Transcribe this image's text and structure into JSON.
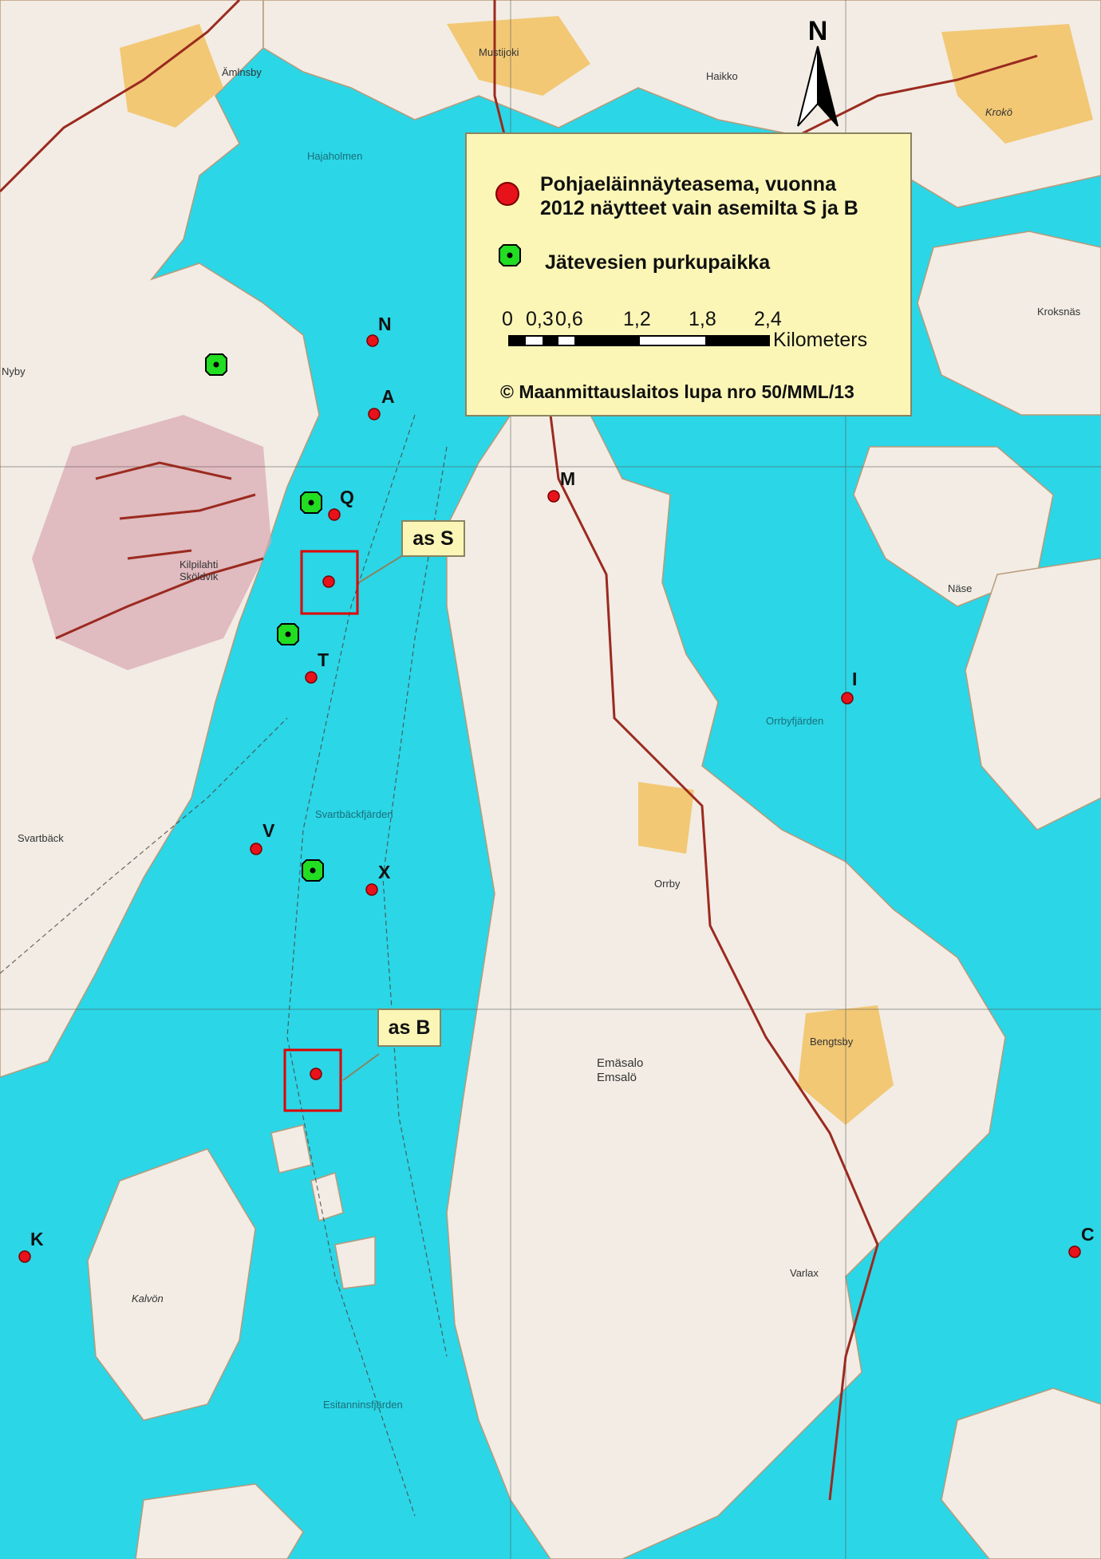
{
  "legend": {
    "station_text_line1": "Pohjaeläinnäyteasema, vuonna",
    "station_text_line2": "2012 näytteet vain asemilta S ja B",
    "outfall_text": "Jätevesien purkupaikka",
    "scale_ticks": [
      "0",
      "0,3",
      "0,6",
      "1,2",
      "1,8",
      "2,4"
    ],
    "scale_unit": "Kilometers",
    "copyright": "© Maanmittauslaitos lupa nro 50/MML/13"
  },
  "north_label": "N",
  "callouts": {
    "s": "as S",
    "b": "as B"
  },
  "stations": [
    "N",
    "A",
    "Q",
    "M",
    "T",
    "I",
    "V",
    "X",
    "K",
    "C"
  ],
  "place_labels": {
    "kilpilahti": "Kilpilahti",
    "skoldvik": "Sköldvik",
    "svartback": "Svartbäck",
    "svartbackfjarden": "Svartbäckfjärden",
    "orrbyfjarden": "Orrbyfjärden",
    "orrby": "Orrby",
    "emasalo": "Emäsalo",
    "emsalo": "Emsalö",
    "bengtsby": "Bengtsby",
    "varlax": "Varlax",
    "kalvon": "Kalvön",
    "esitanninsfjarden": "Esitanninsfjärden",
    "kroko": "Krokö",
    "kroksnas": "Kroksnäs",
    "nybyt": "Nyby",
    "amlnsby": "Ämlnsby",
    "hajaholmen": "Hajaholmen",
    "mustijoki": "Mustijoki",
    "haikko": "Haikko",
    "nase": "Näse"
  },
  "colors": {
    "water": "#2bd6e6",
    "land": "#f2ece4",
    "field": "#f2c261",
    "urban": "#d9a6b0",
    "road": "#9b2a1f",
    "station_red": "#e8121b",
    "outfall_green": "#22dd22",
    "legend_bg": "#fbf6b6"
  }
}
